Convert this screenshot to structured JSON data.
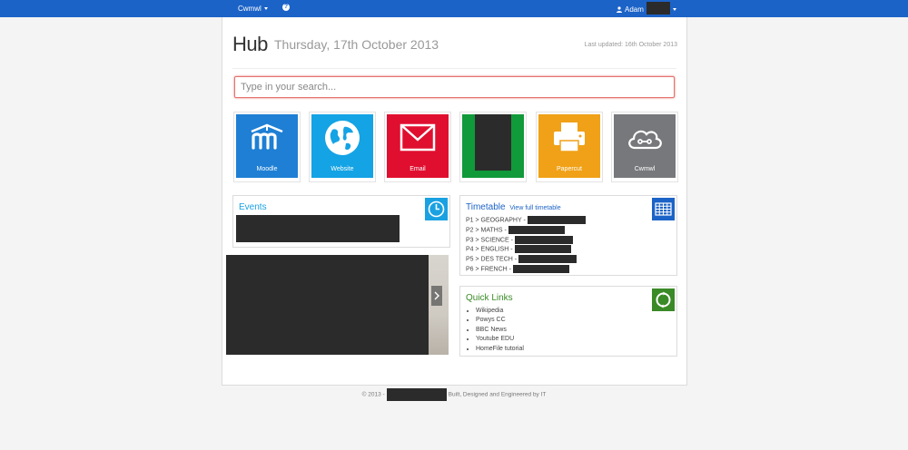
{
  "topbar": {
    "brand": "Cwmwl",
    "help_icon": "question-icon",
    "user_name": "Adam"
  },
  "header": {
    "title": "Hub",
    "date": "Thursday, 17th October 2013",
    "last_updated": "Last updated: 16th October 2013"
  },
  "search": {
    "placeholder": "Type in your search..."
  },
  "tiles": [
    {
      "label": "Moodle",
      "color": "#1e7fd4",
      "icon": "moodle-icon"
    },
    {
      "label": "Website",
      "color": "#14a3e4",
      "icon": "globe-icon"
    },
    {
      "label": "Email",
      "color": "#e00f2f",
      "icon": "envelope-icon"
    },
    {
      "label": "",
      "color": "#109a3a",
      "icon": "redacted"
    },
    {
      "label": "Papercut",
      "color": "#f0a117",
      "icon": "printer-icon"
    },
    {
      "label": "Cwmwl",
      "color": "#77787b",
      "icon": "cloud-icon"
    }
  ],
  "events": {
    "title": "Events",
    "color": "#1aa1e2"
  },
  "timetable": {
    "title": "Timetable",
    "link": "View full timetable",
    "rows": [
      "P1 > GEOGRAPHY -",
      "P2 > MATHS -",
      "P3 > SCIENCE -",
      "P4 > ENGLISH -",
      "P5 > DES TECH -",
      "P6 > FRENCH -"
    ],
    "color": "#1c63c7"
  },
  "quick_links": {
    "title": "Quick Links",
    "items": [
      "Wikipedia",
      "Powys CC",
      "BBC News",
      "Youtube EDU",
      "HomeFile tutorial"
    ],
    "color": "#3a8a27"
  },
  "footer": {
    "prefix": "© 2013 -",
    "suffix": "Built, Designed and Engineered by IT"
  }
}
